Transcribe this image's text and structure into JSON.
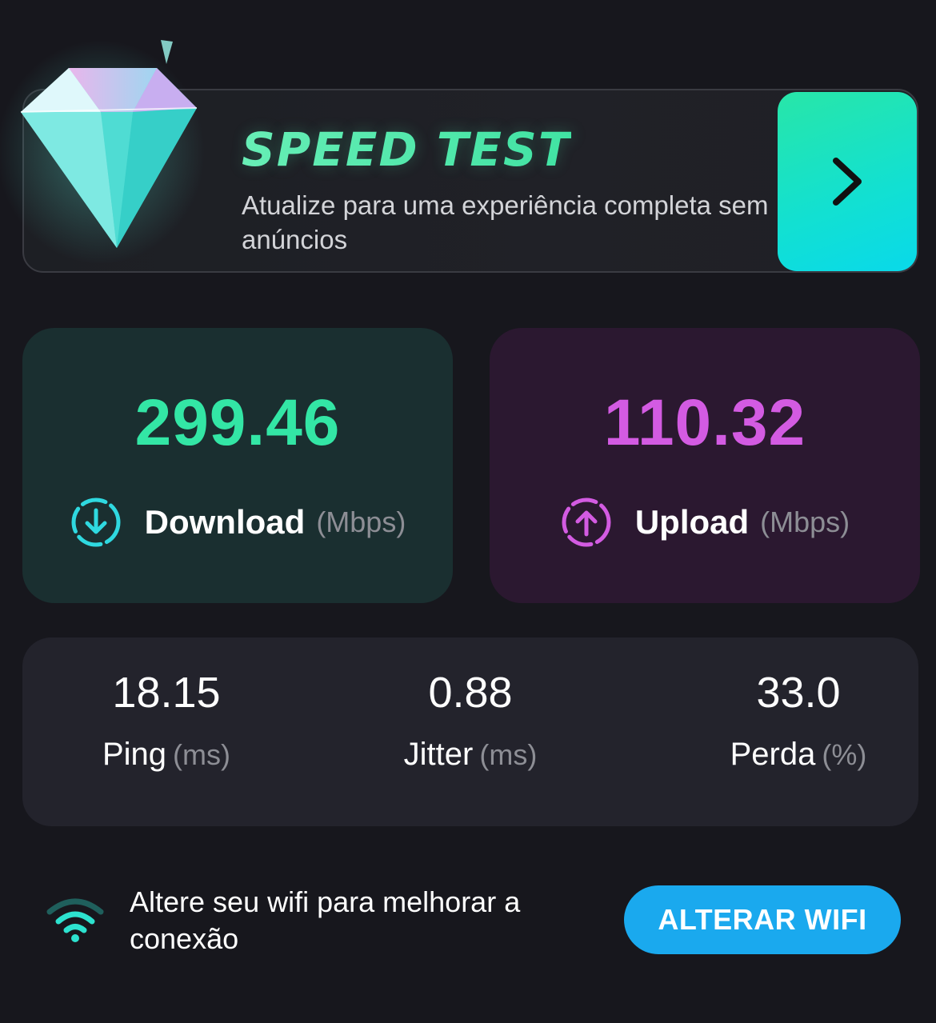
{
  "promo": {
    "title": "SPEED TEST",
    "subtitle": "Atualize para uma experiência completa sem anúncios",
    "arrow_icon": "chevron-right-icon",
    "diamond_icon": "diamond-icon"
  },
  "download": {
    "value": "299.46",
    "label": "Download",
    "unit": "(Mbps)",
    "icon": "download-icon",
    "color": "#33e6a5"
  },
  "upload": {
    "value": "110.32",
    "label": "Upload",
    "unit": "(Mbps)",
    "icon": "upload-icon",
    "color": "#d35be2"
  },
  "metrics": {
    "ping": {
      "value": "18.15",
      "label": "Ping",
      "unit": "(ms)"
    },
    "jitter": {
      "value": "0.88",
      "label": "Jitter",
      "unit": "(ms)"
    },
    "loss": {
      "value": "33.0",
      "label": "Perda",
      "unit": "(%)"
    }
  },
  "wifi": {
    "icon": "wifi-icon",
    "message": "Altere seu wifi para melhorar a conexão",
    "button_label": "ALTERAR WIFI",
    "button_color": "#1aa9ee"
  }
}
